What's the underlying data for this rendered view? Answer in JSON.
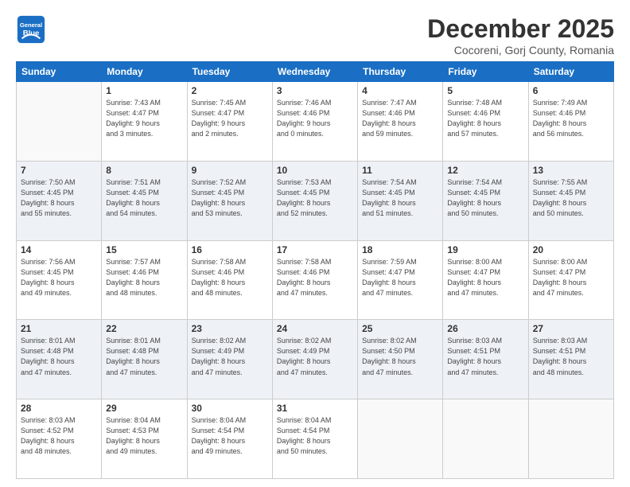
{
  "header": {
    "logo_line1": "General",
    "logo_line2": "Blue",
    "month_title": "December 2025",
    "location": "Cocoreni, Gorj County, Romania"
  },
  "weekdays": [
    "Sunday",
    "Monday",
    "Tuesday",
    "Wednesday",
    "Thursday",
    "Friday",
    "Saturday"
  ],
  "weeks": [
    [
      {
        "day": "",
        "info": ""
      },
      {
        "day": "1",
        "info": "Sunrise: 7:43 AM\nSunset: 4:47 PM\nDaylight: 9 hours\nand 3 minutes."
      },
      {
        "day": "2",
        "info": "Sunrise: 7:45 AM\nSunset: 4:47 PM\nDaylight: 9 hours\nand 2 minutes."
      },
      {
        "day": "3",
        "info": "Sunrise: 7:46 AM\nSunset: 4:46 PM\nDaylight: 9 hours\nand 0 minutes."
      },
      {
        "day": "4",
        "info": "Sunrise: 7:47 AM\nSunset: 4:46 PM\nDaylight: 8 hours\nand 59 minutes."
      },
      {
        "day": "5",
        "info": "Sunrise: 7:48 AM\nSunset: 4:46 PM\nDaylight: 8 hours\nand 57 minutes."
      },
      {
        "day": "6",
        "info": "Sunrise: 7:49 AM\nSunset: 4:46 PM\nDaylight: 8 hours\nand 56 minutes."
      }
    ],
    [
      {
        "day": "7",
        "info": "Sunrise: 7:50 AM\nSunset: 4:45 PM\nDaylight: 8 hours\nand 55 minutes."
      },
      {
        "day": "8",
        "info": "Sunrise: 7:51 AM\nSunset: 4:45 PM\nDaylight: 8 hours\nand 54 minutes."
      },
      {
        "day": "9",
        "info": "Sunrise: 7:52 AM\nSunset: 4:45 PM\nDaylight: 8 hours\nand 53 minutes."
      },
      {
        "day": "10",
        "info": "Sunrise: 7:53 AM\nSunset: 4:45 PM\nDaylight: 8 hours\nand 52 minutes."
      },
      {
        "day": "11",
        "info": "Sunrise: 7:54 AM\nSunset: 4:45 PM\nDaylight: 8 hours\nand 51 minutes."
      },
      {
        "day": "12",
        "info": "Sunrise: 7:54 AM\nSunset: 4:45 PM\nDaylight: 8 hours\nand 50 minutes."
      },
      {
        "day": "13",
        "info": "Sunrise: 7:55 AM\nSunset: 4:45 PM\nDaylight: 8 hours\nand 50 minutes."
      }
    ],
    [
      {
        "day": "14",
        "info": "Sunrise: 7:56 AM\nSunset: 4:45 PM\nDaylight: 8 hours\nand 49 minutes."
      },
      {
        "day": "15",
        "info": "Sunrise: 7:57 AM\nSunset: 4:46 PM\nDaylight: 8 hours\nand 48 minutes."
      },
      {
        "day": "16",
        "info": "Sunrise: 7:58 AM\nSunset: 4:46 PM\nDaylight: 8 hours\nand 48 minutes."
      },
      {
        "day": "17",
        "info": "Sunrise: 7:58 AM\nSunset: 4:46 PM\nDaylight: 8 hours\nand 47 minutes."
      },
      {
        "day": "18",
        "info": "Sunrise: 7:59 AM\nSunset: 4:47 PM\nDaylight: 8 hours\nand 47 minutes."
      },
      {
        "day": "19",
        "info": "Sunrise: 8:00 AM\nSunset: 4:47 PM\nDaylight: 8 hours\nand 47 minutes."
      },
      {
        "day": "20",
        "info": "Sunrise: 8:00 AM\nSunset: 4:47 PM\nDaylight: 8 hours\nand 47 minutes."
      }
    ],
    [
      {
        "day": "21",
        "info": "Sunrise: 8:01 AM\nSunset: 4:48 PM\nDaylight: 8 hours\nand 47 minutes."
      },
      {
        "day": "22",
        "info": "Sunrise: 8:01 AM\nSunset: 4:48 PM\nDaylight: 8 hours\nand 47 minutes."
      },
      {
        "day": "23",
        "info": "Sunrise: 8:02 AM\nSunset: 4:49 PM\nDaylight: 8 hours\nand 47 minutes."
      },
      {
        "day": "24",
        "info": "Sunrise: 8:02 AM\nSunset: 4:49 PM\nDaylight: 8 hours\nand 47 minutes."
      },
      {
        "day": "25",
        "info": "Sunrise: 8:02 AM\nSunset: 4:50 PM\nDaylight: 8 hours\nand 47 minutes."
      },
      {
        "day": "26",
        "info": "Sunrise: 8:03 AM\nSunset: 4:51 PM\nDaylight: 8 hours\nand 47 minutes."
      },
      {
        "day": "27",
        "info": "Sunrise: 8:03 AM\nSunset: 4:51 PM\nDaylight: 8 hours\nand 48 minutes."
      }
    ],
    [
      {
        "day": "28",
        "info": "Sunrise: 8:03 AM\nSunset: 4:52 PM\nDaylight: 8 hours\nand 48 minutes."
      },
      {
        "day": "29",
        "info": "Sunrise: 8:04 AM\nSunset: 4:53 PM\nDaylight: 8 hours\nand 49 minutes."
      },
      {
        "day": "30",
        "info": "Sunrise: 8:04 AM\nSunset: 4:54 PM\nDaylight: 8 hours\nand 49 minutes."
      },
      {
        "day": "31",
        "info": "Sunrise: 8:04 AM\nSunset: 4:54 PM\nDaylight: 8 hours\nand 50 minutes."
      },
      {
        "day": "",
        "info": ""
      },
      {
        "day": "",
        "info": ""
      },
      {
        "day": "",
        "info": ""
      }
    ]
  ]
}
